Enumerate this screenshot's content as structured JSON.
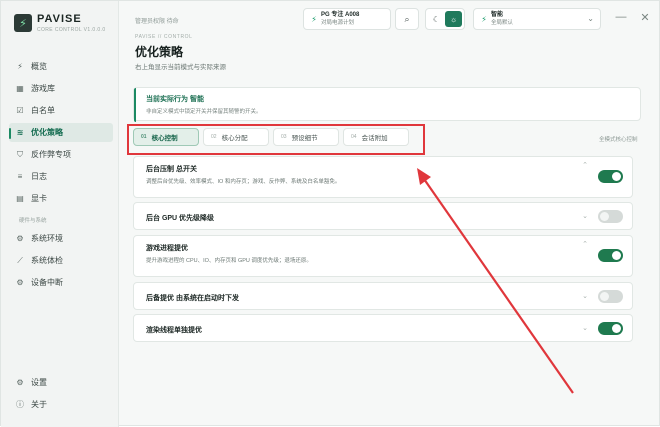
{
  "app": {
    "logo_glyph": "⚡",
    "name": "PAVISE",
    "subtitle": "CORE CONTROL V1.0.0.0"
  },
  "topbar": {
    "privilege": "管理员权限 待命",
    "profile": {
      "icon": "bolt-icon",
      "title": "PG 专注 A008",
      "subtitle": "对局电源计划"
    },
    "search_icon": "search-icon",
    "theme": {
      "dark_icon": "moon-icon",
      "light_icon": "sun-icon",
      "selected": "light"
    },
    "mode": {
      "icon": "bolt-icon",
      "title": "智能",
      "subtitle": "全局默认"
    },
    "window": {
      "minimize": "—",
      "close": "✕"
    }
  },
  "sidebar": {
    "items": [
      {
        "label": "概览",
        "icon": "⚡",
        "icon_name": "bolt-icon",
        "active": false
      },
      {
        "label": "游戏库",
        "icon": "▦",
        "icon_name": "grid-icon",
        "active": false
      },
      {
        "label": "白名单",
        "icon": "☑",
        "icon_name": "checkbox-icon",
        "active": false
      },
      {
        "label": "优化策略",
        "icon": "≋",
        "icon_name": "sliders-icon",
        "active": true
      },
      {
        "label": "反作弊专项",
        "icon": "⛉",
        "icon_name": "shield-icon",
        "active": false
      },
      {
        "label": "日志",
        "icon": "≡",
        "icon_name": "list-icon",
        "active": false
      },
      {
        "label": "显卡",
        "icon": "▤",
        "icon_name": "gpu-icon",
        "active": false
      }
    ],
    "section_label": "硬件与系统",
    "items2": [
      {
        "label": "系统环境",
        "icon": "⚙",
        "icon_name": "gear-icon"
      },
      {
        "label": "系统体检",
        "icon": "⟋",
        "icon_name": "chart-icon"
      },
      {
        "label": "设备中断",
        "icon": "⚙",
        "icon_name": "cog-icon"
      }
    ],
    "bottom": [
      {
        "label": "设置",
        "icon": "⚙",
        "icon_name": "settings-icon"
      },
      {
        "label": "关于",
        "icon": "ⓘ",
        "icon_name": "info-icon"
      }
    ]
  },
  "main": {
    "breadcrumb": "PAVISE  //  CONTROL",
    "title": "优化策略",
    "subtitle": "右上角显示当前模式与实际来源",
    "info": {
      "title": "当前实际行为 智能",
      "desc": "非自定义模式中锁定开关并保留其随警的开关。"
    },
    "tabs": [
      {
        "num": "01",
        "label": "核心控制",
        "active": true
      },
      {
        "num": "02",
        "label": "核心分配",
        "active": false
      },
      {
        "num": "03",
        "label": "预设细节",
        "active": false
      },
      {
        "num": "04",
        "label": "会话附加",
        "active": false
      }
    ],
    "tab_hint": "全模式核心控制",
    "cards": [
      {
        "title": "后台压制 总开关",
        "desc": "调整后台优先级、效率模式、IO 和内存页；游戏、反作弊、系统及白名单豁免。",
        "expanded": true,
        "toggle": true
      },
      {
        "title": "后台 GPU 优先级降级",
        "desc": "",
        "expanded": false,
        "toggle": false
      },
      {
        "title": "游戏进程提优",
        "desc": "提升游戏进程的 CPU、IO、内存页和 GPU 调度优先级；退场还原。",
        "expanded": true,
        "toggle": true
      },
      {
        "title": "后备提优 由系统在启动时下发",
        "desc": "",
        "expanded": false,
        "toggle": false
      },
      {
        "title": "渲染线程单独提优",
        "desc": "",
        "expanded": false,
        "toggle": true
      }
    ]
  },
  "annotation": {
    "color": "#e0373c"
  }
}
